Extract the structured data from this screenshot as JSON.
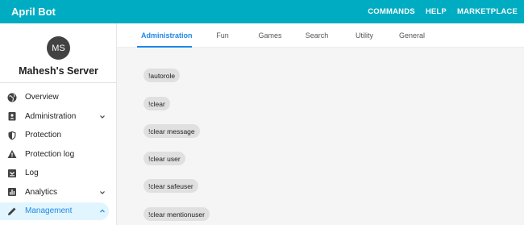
{
  "app": {
    "title": "April Bot"
  },
  "topnav": [
    "COMMANDS",
    "HELP",
    "MARKETPLACE"
  ],
  "server": {
    "initials": "MS",
    "name": "Mahesh's Server"
  },
  "sidebar": {
    "items": [
      {
        "label": "Overview",
        "icon": "globe-icon"
      },
      {
        "label": "Administration",
        "icon": "id-badge-icon",
        "expandable": true
      },
      {
        "label": "Protection",
        "icon": "shield-icon"
      },
      {
        "label": "Protection log",
        "icon": "warning-icon"
      },
      {
        "label": "Log",
        "icon": "inbox-icon"
      },
      {
        "label": "Analytics",
        "icon": "bar-chart-icon",
        "expandable": true
      },
      {
        "label": "Management",
        "icon": "pencil-icon",
        "expandable": true,
        "active": true
      }
    ]
  },
  "tabs": [
    "Administration",
    "Fun",
    "Games",
    "Search",
    "Utility",
    "General"
  ],
  "active_tab": "Administration",
  "commands": [
    "!autorole",
    "!clear",
    "!clear message",
    "!clear user",
    "!clear safeuser",
    "!clear mentionuser"
  ],
  "colors": {
    "header": "#00acc1",
    "accent": "#1e88e5",
    "active_bg": "#e1f5fe",
    "chip_bg": "#e0e0e0"
  }
}
